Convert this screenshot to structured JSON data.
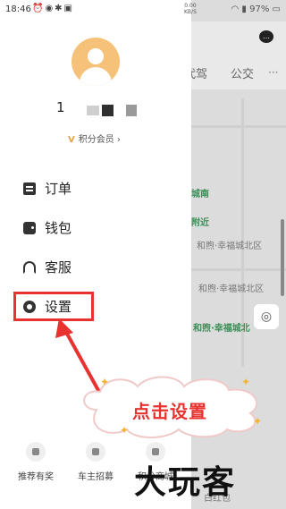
{
  "status_bar": {
    "time": "18:46",
    "speed_value": "0.00",
    "speed_unit": "KB/S",
    "battery": "97%"
  },
  "map": {
    "tabs": [
      "代驾",
      "公交"
    ],
    "labels": [
      "城南",
      "附近",
      "和煦·幸福城北区",
      "和煦·幸福城北区",
      "和煦·幸福城北",
      "白红包"
    ]
  },
  "drawer": {
    "username": "1",
    "member_label": "积分会员 ›",
    "menu": [
      {
        "label": "订单",
        "icon": "order-icon"
      },
      {
        "label": "钱包",
        "icon": "wallet-icon"
      },
      {
        "label": "客服",
        "icon": "headset-icon"
      },
      {
        "label": "设置",
        "icon": "settings-icon"
      }
    ],
    "bottom": [
      {
        "label": "推荐有奖"
      },
      {
        "label": "车主招募"
      },
      {
        "label": "积分商城"
      }
    ]
  },
  "annotation": {
    "callout": "点击设置",
    "watermark": "大玩客"
  },
  "colors": {
    "annotation_red": "#e8322f",
    "avatar": "#f6c27a",
    "map_green": "#3b8f57"
  }
}
